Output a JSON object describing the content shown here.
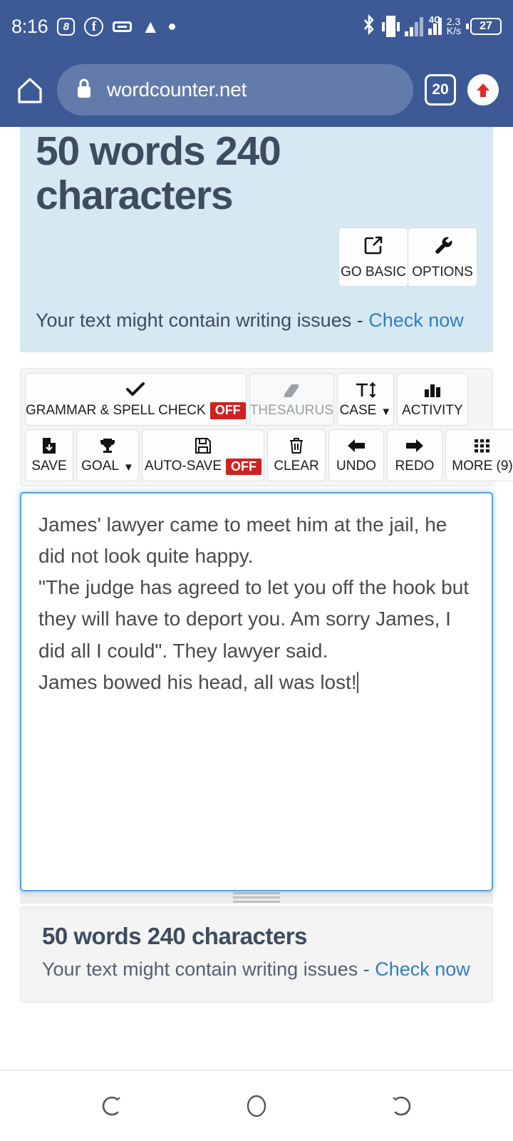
{
  "status_bar": {
    "time": "8:16",
    "app_badge_label": "8",
    "facebook_label": "f",
    "icons": [
      "app-badge-icon",
      "facebook-icon",
      "message-icon",
      "warning-icon",
      "dot-icon"
    ],
    "bluetooth_icon": "bluetooth-icon",
    "vibrate_icon": "vibrate-icon",
    "signal_icon": "signal-bars-icon",
    "network_type": "4G",
    "data_rate_value": "2.3",
    "data_rate_unit": "K/s",
    "battery_level": "27"
  },
  "browser": {
    "home_icon": "home-icon",
    "lock_icon": "lock-icon",
    "url": "wordcounter.net",
    "tab_count": "20",
    "scroll_icon": "scroll-up-icon"
  },
  "hero": {
    "title": "50 words 240 characters",
    "note_text": "Your text might contain writing issues - ",
    "note_link": "Check now",
    "buttons": [
      {
        "label": "GO BASIC",
        "icon": "external-link-icon"
      },
      {
        "label": "OPTIONS",
        "icon": "wrench-icon"
      }
    ]
  },
  "toolbar": {
    "row1": [
      {
        "label": "GRAMMAR & SPELL CHECK",
        "badge": "OFF",
        "icon": "checkmark-icon",
        "disabled": false
      },
      {
        "label": "THESAURUS",
        "badge": "",
        "icon": "book-icon",
        "disabled": true
      },
      {
        "label": "CASE",
        "badge": "",
        "icon": "text-size-icon",
        "caret": "▼",
        "disabled": false
      },
      {
        "label": "ACTIVITY",
        "badge": "",
        "icon": "bar-chart-icon",
        "disabled": false
      }
    ],
    "row2": [
      {
        "label": "SAVE",
        "badge": "",
        "icon": "file-download-icon"
      },
      {
        "label": "GOAL",
        "badge": "",
        "icon": "trophy-icon",
        "caret": "▼"
      },
      {
        "label": "AUTO-SAVE",
        "badge": "OFF",
        "icon": "floppy-disk-icon"
      },
      {
        "label": "CLEAR",
        "badge": "",
        "icon": "trash-icon"
      },
      {
        "label": "UNDO",
        "badge": "",
        "icon": "arrow-left-icon"
      },
      {
        "label": "REDO",
        "badge": "",
        "icon": "arrow-right-icon"
      },
      {
        "label": "MORE (9)",
        "badge": "",
        "icon": "grid-icon"
      }
    ]
  },
  "editor": {
    "text": "James' lawyer came to meet him at the jail, he did not look quite happy.\n\"The judge has agreed to let you off the hook but they will have to deport you. Am sorry James, I did all I could\". They lawyer said.\nJames bowed his head, all was lost!"
  },
  "footer": {
    "title": "50 words 240 characters",
    "note_text": "Your text might contain writing issues - ",
    "note_link": "Check now"
  },
  "nav_bar": {
    "recents_icon": "recents-icon",
    "home_icon": "home-circle-icon",
    "back_icon": "back-icon"
  },
  "colors": {
    "chrome": "#3d5a96",
    "hero_bg": "#d6e8f2",
    "accent_link": "#2f7fc1",
    "off_badge": "#cf2222",
    "editor_border": "#57a0e0",
    "heading": "#3f4b5e"
  }
}
